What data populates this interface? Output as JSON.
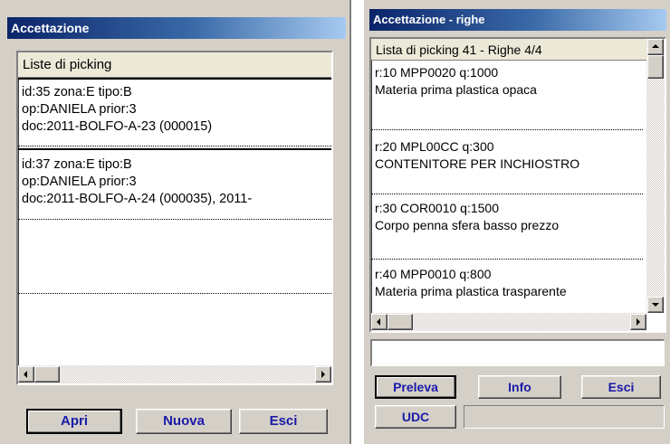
{
  "left_window": {
    "title": "Accettazione",
    "list_header": "Liste di picking",
    "items": [
      {
        "line1": "id:35  zona:E  tipo:B",
        "line2": "op:DANIELA  prior:3",
        "line3": "doc:2011-BOLFO-A-23 (000015)"
      },
      {
        "line1": "id:37  zona:E  tipo:B",
        "line2": "op:DANIELA  prior:3",
        "line3": "doc:2011-BOLFO-A-24 (000035), 2011-"
      }
    ],
    "buttons": {
      "open": "Apri",
      "new": "Nuova",
      "exit": "Esci"
    }
  },
  "right_window": {
    "title": "Accettazione - righe",
    "list_header": "Lista di picking 41 - Righe 4/4",
    "rows": [
      {
        "line1": "r:10  MPP0020  q:1000",
        "line2": "Materia prima plastica opaca"
      },
      {
        "line1": "r:20  MPL00CC  q:300",
        "line2": "CONTENITORE PER INCHIOSTRO"
      },
      {
        "line1": "r:30  COR0010  q:1500",
        "line2": "Corpo penna sfera basso prezzo"
      },
      {
        "line1": "r:40  MPP0010  q:800",
        "line2": "Materia prima plastica trasparente"
      }
    ],
    "input_value": "",
    "buttons": {
      "take": "Preleva",
      "info": "Info",
      "exit": "Esci",
      "udc": "UDC"
    },
    "status_value": ""
  },
  "colors": {
    "title_gradient_start": "#0a246a",
    "title_gradient_end": "#a6caf0",
    "button_text": "#1a1aa8",
    "window_face": "#d4d0c8"
  }
}
